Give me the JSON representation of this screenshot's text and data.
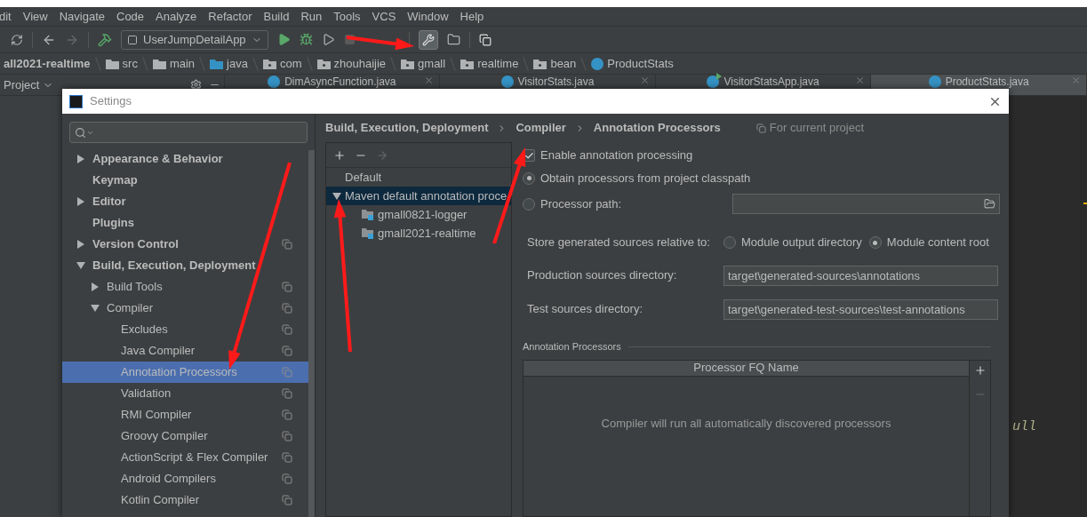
{
  "menu_bar": [
    "dit",
    "View",
    "Navigate",
    "Code",
    "Analyze",
    "Refactor",
    "Build",
    "Run",
    "Tools",
    "VCS",
    "Window",
    "Help"
  ],
  "toolbar": {
    "run_configuration": "UserJumpDetailApp",
    "settings_pressed": true
  },
  "breadcrumbs": [
    {
      "label": "all2021-realtime",
      "kind": "module"
    },
    {
      "label": "src",
      "kind": "folder"
    },
    {
      "label": "main",
      "kind": "folder"
    },
    {
      "label": "java",
      "kind": "source"
    },
    {
      "label": "com",
      "kind": "package"
    },
    {
      "label": "zhouhaijie",
      "kind": "package"
    },
    {
      "label": "gmall",
      "kind": "package"
    },
    {
      "label": "realtime",
      "kind": "package"
    },
    {
      "label": "bean",
      "kind": "package"
    },
    {
      "label": "ProductStats",
      "kind": "class"
    }
  ],
  "project_panel": {
    "title": "Project"
  },
  "editor_tabs": [
    {
      "label": "DimAsyncFunction.java",
      "kind": "class",
      "selected": false
    },
    {
      "label": "VisitorStats.java",
      "kind": "class",
      "selected": false
    },
    {
      "label": "VisitorStatsApp.java",
      "kind": "runnable",
      "selected": false
    },
    {
      "label": "ProductStats.java",
      "kind": "class",
      "selected": true
    }
  ],
  "editor": {
    "visible_text": "ull"
  },
  "dialog": {
    "title": "Settings",
    "tree": [
      {
        "label": "Appearance & Behavior",
        "expanded": false,
        "project_scope": false,
        "selected": false
      },
      {
        "label": "Keymap",
        "project_scope": false,
        "selected": false
      },
      {
        "label": "Editor",
        "expanded": false,
        "project_scope": false,
        "selected": false
      },
      {
        "label": "Plugins",
        "project_scope": false,
        "selected": false
      },
      {
        "label": "Version Control",
        "expanded": false,
        "project_scope": true,
        "selected": false
      },
      {
        "label": "Build, Execution, Deployment",
        "expanded": true,
        "project_scope": false,
        "selected": false,
        "children": [
          {
            "label": "Build Tools",
            "expanded": false,
            "project_scope": true,
            "selected": false
          },
          {
            "label": "Compiler",
            "expanded": true,
            "project_scope": true,
            "selected": false,
            "children": [
              {
                "label": "Excludes",
                "project_scope": true,
                "selected": false
              },
              {
                "label": "Java Compiler",
                "project_scope": true,
                "selected": false
              },
              {
                "label": "Annotation Processors",
                "project_scope": true,
                "selected": true
              },
              {
                "label": "Validation",
                "project_scope": true,
                "selected": false
              },
              {
                "label": "RMI Compiler",
                "project_scope": true,
                "selected": false
              },
              {
                "label": "Groovy Compiler",
                "project_scope": true,
                "selected": false
              },
              {
                "label": "ActionScript & Flex Compiler",
                "project_scope": true,
                "selected": false
              },
              {
                "label": "Android Compilers",
                "project_scope": true,
                "selected": false
              },
              {
                "label": "Kotlin Compiler",
                "project_scope": true,
                "selected": false
              }
            ]
          }
        ]
      }
    ],
    "path": [
      "Build, Execution, Deployment",
      "Compiler",
      "Annotation Processors"
    ],
    "scope_note": "For current project",
    "profiles": [
      {
        "label": "Default",
        "selected": false
      },
      {
        "label": "Maven default annotation proce",
        "selected": true,
        "expanded": true,
        "children": [
          {
            "label": "gmall0821-logger"
          },
          {
            "label": "gmall2021-realtime"
          }
        ]
      }
    ],
    "enable_processing": {
      "label": "Enable annotation processing",
      "checked": true
    },
    "processor_source": [
      {
        "label": "Obtain processors from project classpath",
        "selected": true
      },
      {
        "label": "Processor path:",
        "selected": false
      }
    ],
    "store_relative": {
      "label": "Store generated sources relative to:",
      "options": [
        {
          "label": "Module output directory",
          "selected": false
        },
        {
          "label": "Module content root",
          "selected": true
        }
      ]
    },
    "fields": [
      {
        "label": "Production sources directory:",
        "value": "target\\generated-sources\\annotations"
      },
      {
        "label": "Test sources directory:",
        "value": "target\\generated-test-sources\\test-annotations"
      }
    ],
    "processors_section": {
      "title": "Annotation Processors",
      "column": "Processor FQ Name",
      "empty_text": "Compiler will run all automatically discovered processors"
    }
  }
}
